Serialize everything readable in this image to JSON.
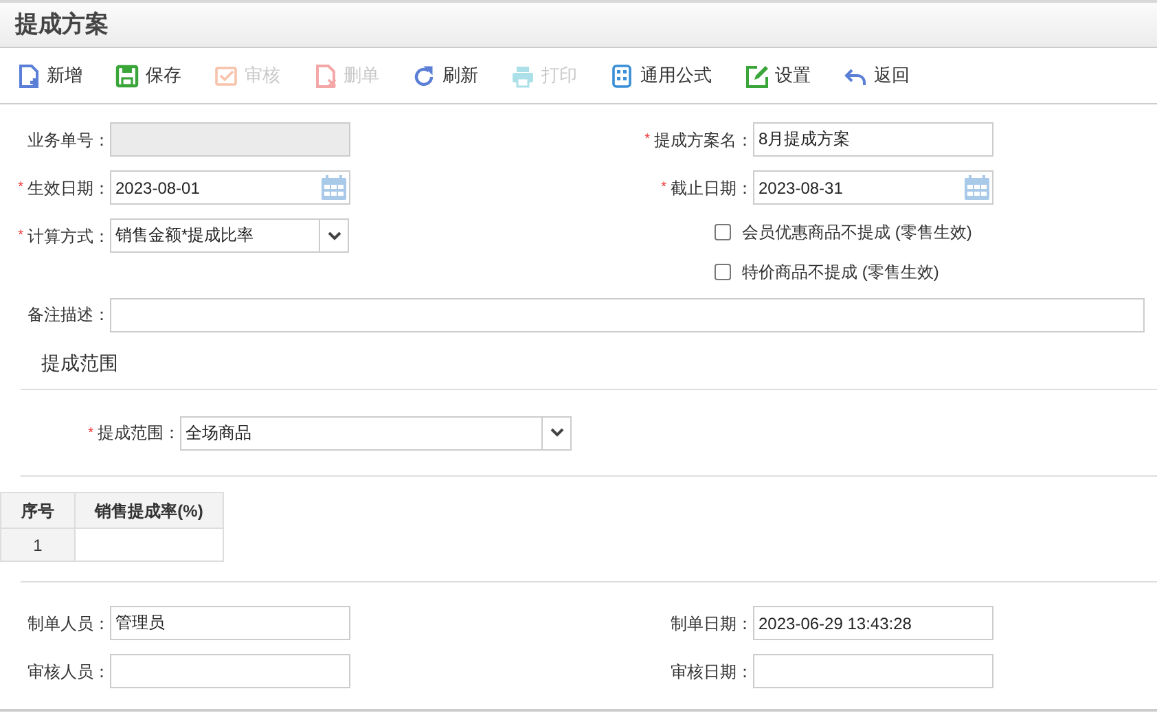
{
  "page_title": "提成方案",
  "toolbar": [
    {
      "kind": "new",
      "label": "新增",
      "disabled": false
    },
    {
      "kind": "save",
      "label": "保存",
      "disabled": false
    },
    {
      "kind": "audit",
      "label": "审核",
      "disabled": true
    },
    {
      "kind": "delete",
      "label": "删单",
      "disabled": true
    },
    {
      "kind": "refresh",
      "label": "刷新",
      "disabled": false
    },
    {
      "kind": "print",
      "label": "打印",
      "disabled": true
    },
    {
      "kind": "formula",
      "label": "通用公式",
      "disabled": false
    },
    {
      "kind": "settings",
      "label": "设置",
      "disabled": false
    },
    {
      "kind": "back",
      "label": "返回",
      "disabled": false
    }
  ],
  "left_fields": [
    {
      "kind": "text",
      "label": "业务单号：",
      "disabled": true
    },
    {
      "kind": "date",
      "marker": "*",
      "label": "生效日期：",
      "disabled": false,
      "value": "2023-08-01"
    },
    {
      "kind": "select",
      "marker": "*",
      "label": "计算方式：",
      "disabled": false,
      "value": "销售金额*提成比率"
    }
  ],
  "right_fields": [
    {
      "kind": "text",
      "marker": "*",
      "label": "提成方案名：",
      "disabled": false,
      "value": "8月提成方案"
    },
    {
      "kind": "date",
      "marker": "*",
      "label": "截止日期：",
      "disabled": false,
      "value": "2023-08-31"
    },
    {
      "kind": "checkbox",
      "label": "会员优惠商品不提成 (零售生效)",
      "checked": false
    },
    {
      "kind": "checkbox",
      "label": "特价商品不提成 (零售生效)",
      "checked": false
    }
  ],
  "remark": {
    "label": "备注描述："
  },
  "scope_section": {
    "title": "提成范围",
    "field": {
      "kind": "select",
      "marker": "*",
      "label": "提成范围：",
      "disabled": false,
      "value": "全场商品"
    }
  },
  "rate_table": {
    "columns": [
      "序号",
      "销售提成率(%)"
    ],
    "rows": [
      {
        "index": "1"
      }
    ]
  },
  "footer_left": [
    {
      "kind": "text",
      "label": "制单人员：",
      "disabled": false,
      "value": "管理员"
    },
    {
      "kind": "text",
      "label": "审核人员：",
      "disabled": false
    }
  ],
  "footer_right": [
    {
      "kind": "text",
      "label": "制单日期：",
      "disabled": false,
      "value": "2023-06-29 13:43:28"
    },
    {
      "kind": "text",
      "label": "审核日期：",
      "disabled": false
    }
  ]
}
